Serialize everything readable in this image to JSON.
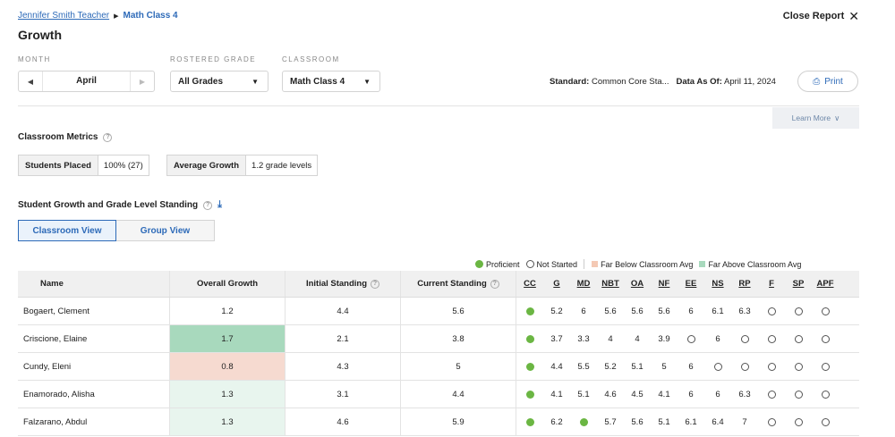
{
  "breadcrumb": {
    "teacher": "Jennifer Smith Teacher",
    "class": "Math Class 4"
  },
  "page_title": "Growth",
  "close_label": "Close Report",
  "filters": {
    "month_label": "MONTH",
    "month_value": "April",
    "grade_label": "ROSTERED GRADE",
    "grade_value": "All Grades",
    "class_label": "CLASSROOM",
    "class_value": "Math Class 4"
  },
  "standard": {
    "label": "Standard:",
    "value": "Common Core Sta...",
    "asof_label": "Data As Of:",
    "asof_value": "April 11, 2024"
  },
  "print_label": "Print",
  "learn_more_label": "Learn More",
  "metrics": {
    "heading": "Classroom Metrics",
    "placed_label": "Students Placed",
    "placed_value": "100% (27)",
    "growth_label": "Average Growth",
    "growth_value": "1.2 grade levels"
  },
  "standing": {
    "heading": "Student Growth and Grade Level Standing"
  },
  "views": {
    "classroom": "Classroom View",
    "group": "Group View"
  },
  "legend": {
    "proficient": "Proficient",
    "not_started": "Not Started",
    "below": "Far Below Classroom Avg",
    "above": "Far Above Classroom Avg",
    "proficient_color": "#6bb643",
    "below_color": "#f6dad0",
    "above_color": "#a8d9bd"
  },
  "table": {
    "headers": {
      "name": "Name",
      "overall": "Overall Growth",
      "initial": "Initial Standing",
      "current": "Current Standing"
    },
    "domains": [
      "CC",
      "G",
      "MD",
      "NBT",
      "OA",
      "NF",
      "EE",
      "NS",
      "RP",
      "F",
      "SP",
      "APF"
    ],
    "rows": [
      {
        "name": "Bogaert, Clement",
        "overall": "1.2",
        "initial": "4.4",
        "current": "5.6",
        "highlight": "none",
        "domains": [
          "P",
          "5.2",
          "6",
          "5.6",
          "5.6",
          "5.6",
          "6",
          "6.1",
          "6.3",
          "O",
          "O",
          "O"
        ]
      },
      {
        "name": "Criscione, Elaine",
        "overall": "1.7",
        "initial": "2.1",
        "current": "3.8",
        "highlight": "above",
        "domains": [
          "P",
          "3.7",
          "3.3",
          "4",
          "4",
          "3.9",
          "O",
          "6",
          "O",
          "O",
          "O",
          "O"
        ]
      },
      {
        "name": "Cundy, Eleni",
        "overall": "0.8",
        "initial": "4.3",
        "current": "5",
        "highlight": "below",
        "domains": [
          "P",
          "4.4",
          "5.5",
          "5.2",
          "5.1",
          "5",
          "6",
          "O",
          "O",
          "O",
          "O",
          "O"
        ]
      },
      {
        "name": "Enamorado, Alisha",
        "overall": "1.3",
        "initial": "3.1",
        "current": "4.4",
        "highlight": "light",
        "domains": [
          "P",
          "4.1",
          "5.1",
          "4.6",
          "4.5",
          "4.1",
          "6",
          "6",
          "6.3",
          "O",
          "O",
          "O"
        ]
      },
      {
        "name": "Falzarano, Abdul",
        "overall": "1.3",
        "initial": "4.6",
        "current": "5.9",
        "highlight": "light",
        "domains": [
          "P",
          "6.2",
          "P",
          "5.7",
          "5.6",
          "5.1",
          "6.1",
          "6.4",
          "7",
          "O",
          "O",
          "O"
        ]
      }
    ]
  }
}
